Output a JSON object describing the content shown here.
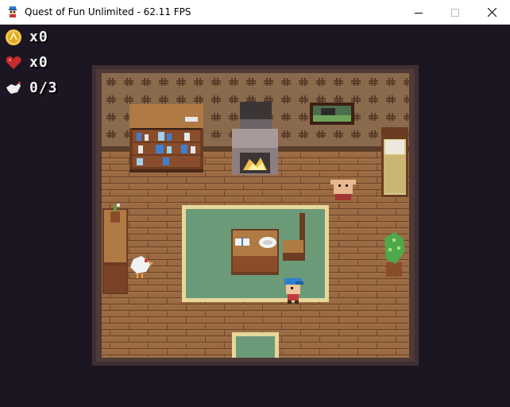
{
  "window": {
    "title": "Quest of Fun Unlimited - 62.11 FPS",
    "min_icon": "minimize-icon",
    "max_icon": "maximize-icon",
    "close_icon": "close-icon"
  },
  "hud": {
    "coins": "x0",
    "hearts": "x0",
    "chickens": "0/3"
  },
  "colors": {
    "background": "#1b1622",
    "wall": "#8a6a4c",
    "floor": "#9a6a43",
    "rug": "#6b9a79",
    "rug_border": "#e6d79b"
  }
}
